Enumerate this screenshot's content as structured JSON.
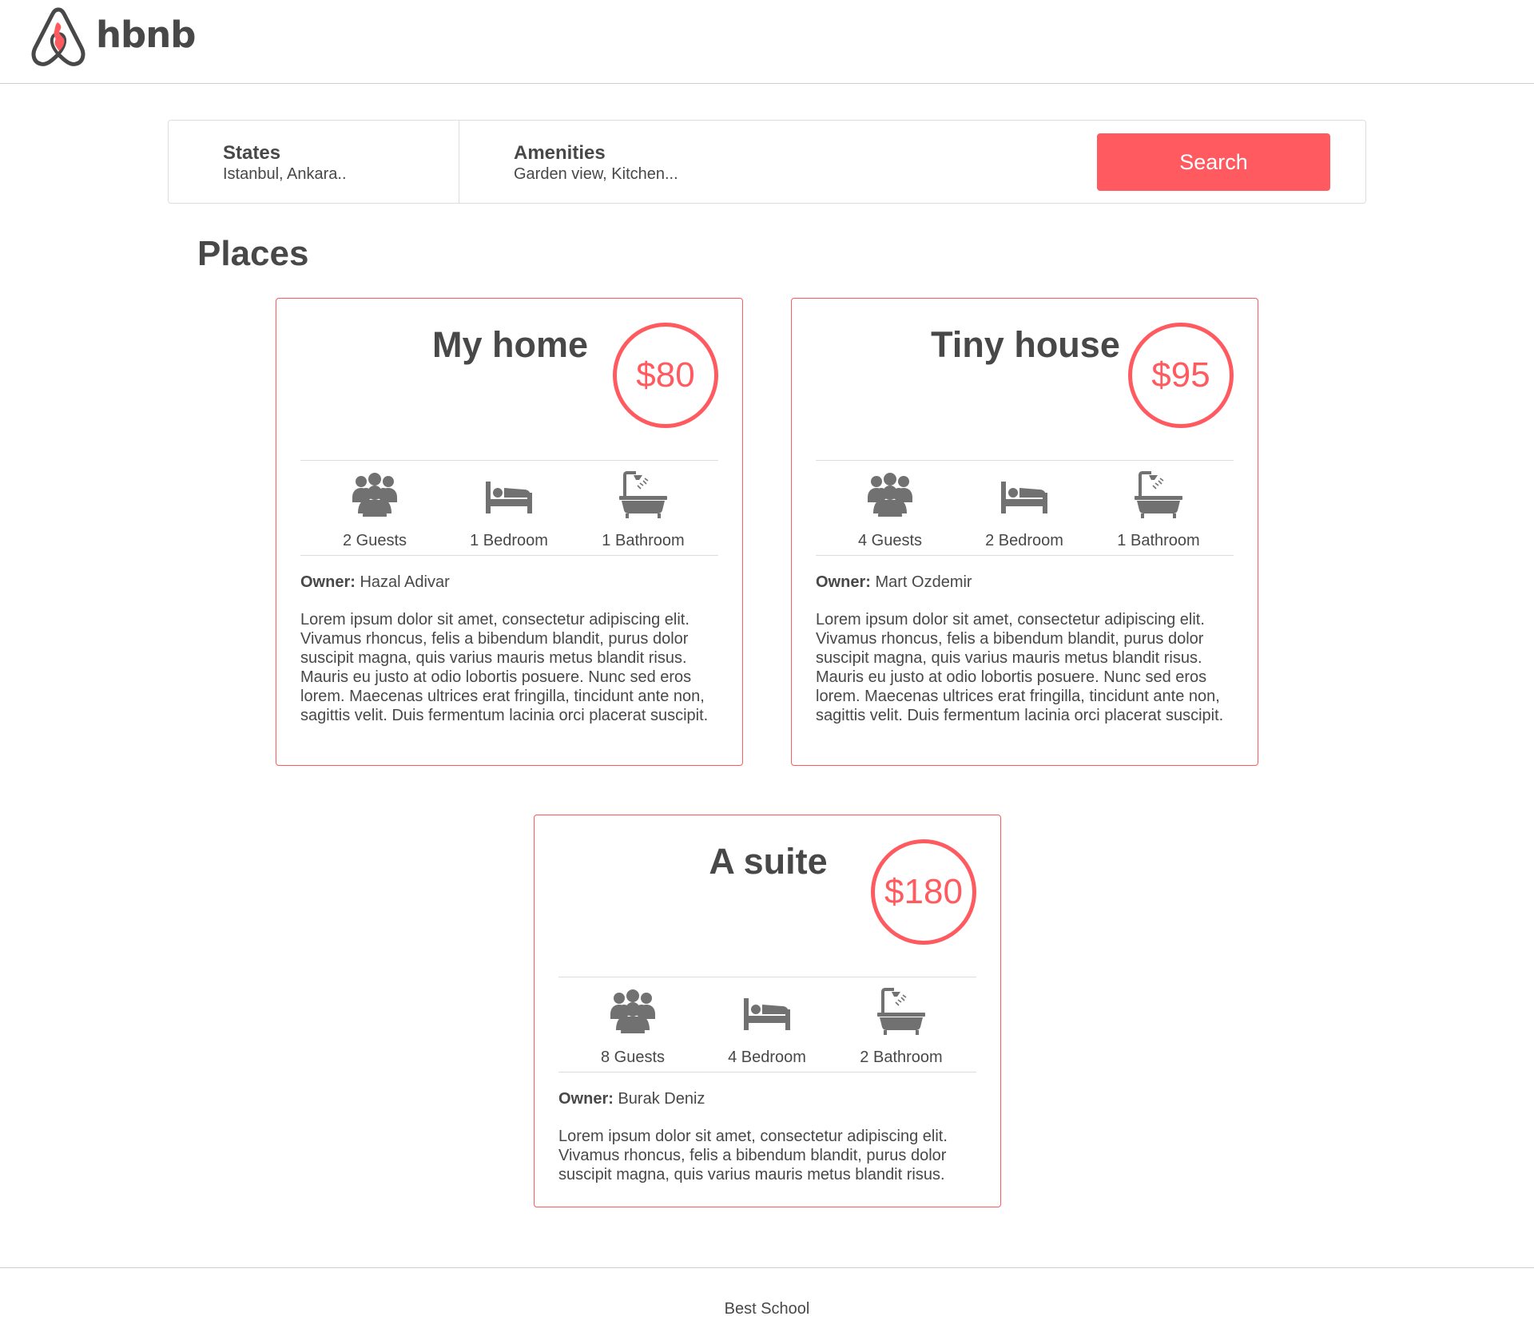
{
  "header": {
    "logo_text": "hbnb"
  },
  "filters": {
    "states": {
      "title": "States",
      "value": "Istanbul, Ankara.."
    },
    "amenities": {
      "title": "Amenities",
      "value": "Garden view, Kitchen..."
    },
    "search_label": "Search"
  },
  "places": {
    "title": "Places",
    "items": [
      {
        "name": "My home",
        "price": "$80",
        "guests": "2 Guests",
        "rooms": "1 Bedroom",
        "baths": "1 Bathroom",
        "owner_label": "Owner:",
        "owner_name": "Hazal Adivar",
        "description": "Lorem ipsum dolor sit amet, consectetur adipiscing elit. Vivamus rhoncus, felis a bibendum blandit, purus dolor suscipit magna, quis varius mauris metus blandit risus. Mauris eu justo at odio lobortis posuere. Nunc sed eros lorem. Maecenas ultrices erat fringilla, tincidunt ante non, sagittis velit. Duis fermentum lacinia orci placerat suscipit."
      },
      {
        "name": "Tiny house",
        "price": "$95",
        "guests": "4 Guests",
        "rooms": "2 Bedroom",
        "baths": "1 Bathroom",
        "owner_label": "Owner:",
        "owner_name": "Mart Ozdemir",
        "description": "Lorem ipsum dolor sit amet, consectetur adipiscing elit. Vivamus rhoncus, felis a bibendum blandit, purus dolor suscipit magna, quis varius mauris metus blandit risus. Mauris eu justo at odio lobortis posuere. Nunc sed eros lorem. Maecenas ultrices erat fringilla, tincidunt ante non, sagittis velit. Duis fermentum lacinia orci placerat suscipit."
      },
      {
        "name": "A suite",
        "price": "$180",
        "guests": "8 Guests",
        "rooms": "4 Bedroom",
        "baths": "2 Bathroom",
        "owner_label": "Owner:",
        "owner_name": "Burak Deniz",
        "description": "Lorem ipsum dolor sit amet, consectetur adipiscing elit. Vivamus rhoncus, felis a bibendum blandit, purus dolor suscipit magna, quis varius mauris metus blandit risus."
      }
    ]
  },
  "footer": {
    "text": "Best School"
  },
  "icons": {
    "logo": "hbnb-logo-icon",
    "guests": "group-icon",
    "rooms": "bed-icon",
    "baths": "bathtub-icon"
  },
  "colors": {
    "accent": "#ff5a5f",
    "text": "#484848",
    "icon": "#717171",
    "border": "#dddddd"
  }
}
